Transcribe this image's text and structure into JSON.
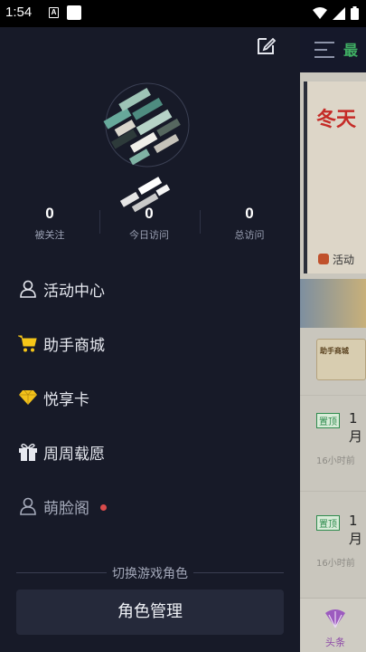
{
  "status_bar": {
    "time": "1:54",
    "notif_letter": "A"
  },
  "profile": {
    "stats": [
      {
        "value": "0",
        "label": "被关注"
      },
      {
        "value": "0",
        "label": "今日访问"
      },
      {
        "value": "0",
        "label": "总访问"
      }
    ]
  },
  "menu": [
    {
      "label": "活动中心",
      "icon": "person-icon"
    },
    {
      "label": "助手商城",
      "icon": "cart-icon"
    },
    {
      "label": "悦享卡",
      "icon": "diamond-icon"
    },
    {
      "label": "周周载愿",
      "icon": "gift-icon"
    },
    {
      "label": "萌脸阁",
      "icon": "person-outline-icon",
      "has_dot": true
    }
  ],
  "switch_role": {
    "label": "切换游戏角色",
    "button": "角色管理"
  },
  "background": {
    "tab_label": "最",
    "banner_title": "冬天",
    "banner_sub": "活动",
    "banner_activity": "活动",
    "card_label": "助手商城",
    "rows": [
      {
        "tag": "置顶",
        "title": "1月",
        "time": "16小时前"
      },
      {
        "tag": "置顶",
        "title": "1月",
        "time": "16小时前"
      }
    ],
    "bottom_label": "头条"
  },
  "colors": {
    "drawer_bg": "#171a28",
    "cart_yellow": "#f5c518",
    "diamond_yellow": "#f2c21b",
    "dot_red": "#d94b4b"
  }
}
